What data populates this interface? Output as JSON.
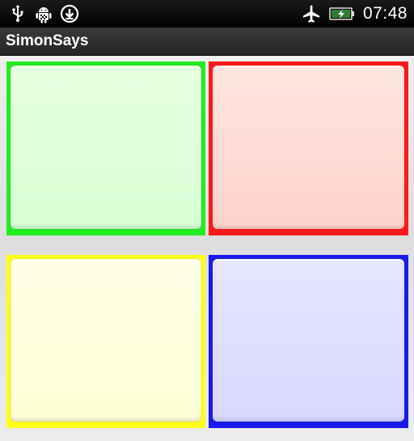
{
  "status_bar": {
    "left_icons": [
      "usb-icon",
      "android-debug-icon",
      "download-icon"
    ],
    "right_icons": [
      "airplane-mode-icon",
      "battery-charging-icon"
    ],
    "time": "07:48"
  },
  "app": {
    "title": "SimonSays"
  },
  "pads": [
    {
      "name": "green",
      "border_color": "#22ee22",
      "fill_color": "#dfffd9"
    },
    {
      "name": "red",
      "border_color": "#ff1a1a",
      "fill_color": "#ffdcd6"
    },
    {
      "name": "yellow",
      "border_color": "#ffff1a",
      "fill_color": "#ffffdd"
    },
    {
      "name": "blue",
      "border_color": "#1a1aee",
      "fill_color": "#dedeff"
    }
  ]
}
